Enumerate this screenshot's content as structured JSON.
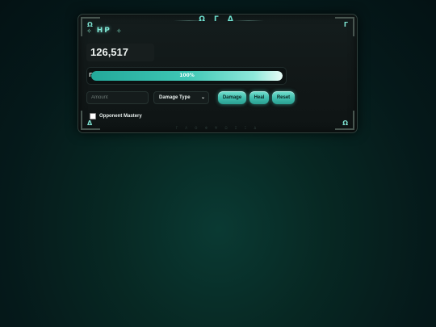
{
  "header": {
    "top_symbols": "Ω Γ Δ",
    "corner_runes": {
      "tl": "Ω",
      "tr": "Γ",
      "bl": "Δ",
      "br": "Ω"
    },
    "spark": "✧",
    "title": "HP"
  },
  "hp": {
    "value": "126,517"
  },
  "health_bar": {
    "rune": "Γ",
    "percent_label": "100%",
    "fill_fraction": 1.0
  },
  "controls": {
    "amount_placeholder": "Amount",
    "damage_type_selected": "Damage Type",
    "damage_label": "Damage",
    "heal_label": "Heal",
    "reset_label": "Reset"
  },
  "mastery": {
    "label": "Opponent Mastery",
    "checked": false
  },
  "footer": {
    "runes": "Γ Λ Θ Φ Ψ Ω Σ Ξ Δ"
  },
  "colors": {
    "accent": "#3fc7b5",
    "panel": "#121919",
    "background": "#072823"
  }
}
